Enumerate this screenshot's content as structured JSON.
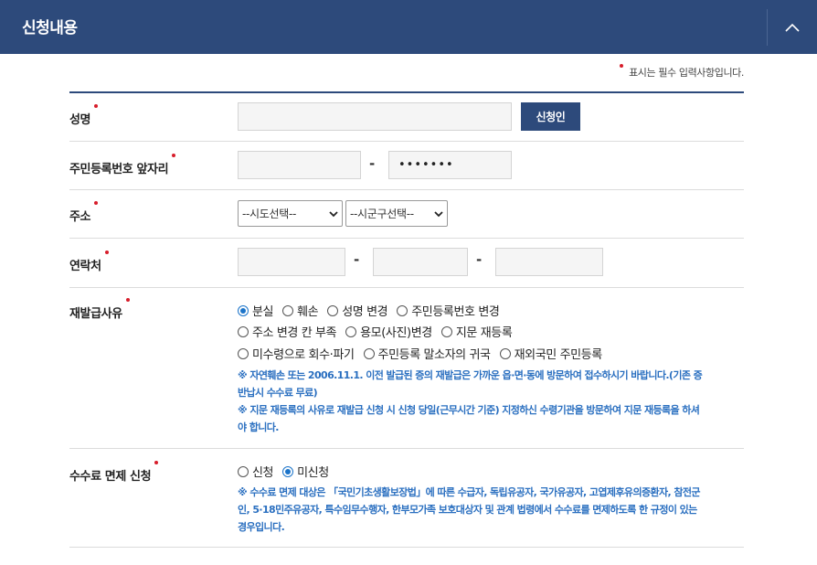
{
  "header": {
    "title": "신청내용",
    "collapse_icon": "chevron-up-icon"
  },
  "required_note": "표시는 필수 입력사항입니다.",
  "accent_color": "#2d4a7b",
  "required_dot_color": "#d71d2b",
  "note_color": "#2a6fc0",
  "name_row": {
    "label": "성명",
    "value": "",
    "button_label": "신청인"
  },
  "rrn_row": {
    "label": "주민등록번호 앞자리",
    "front_value": "",
    "back_value": "•••••••",
    "separator": "-"
  },
  "address_row": {
    "label": "주소",
    "sido_selected": "--시도선택--",
    "sigungu_selected": "--시군구선택--"
  },
  "contact_row": {
    "label": "연락처",
    "part1": "",
    "part2": "",
    "part3": "",
    "separator": "-"
  },
  "reason_row": {
    "label": "재발급사유",
    "lines": [
      [
        {
          "label": "분실",
          "checked": true
        },
        {
          "label": "훼손",
          "checked": false
        },
        {
          "label": "성명 변경",
          "checked": false
        },
        {
          "label": "주민등록번호 변경",
          "checked": false
        }
      ],
      [
        {
          "label": "주소 변경 칸 부족",
          "checked": false
        },
        {
          "label": "용모(사진)변경",
          "checked": false
        },
        {
          "label": "지문 재등록",
          "checked": false
        }
      ],
      [
        {
          "label": "미수령으로 회수·파기",
          "checked": false
        },
        {
          "label": "주민등록 말소자의 귀국",
          "checked": false
        },
        {
          "label": "재외국민 주민등록",
          "checked": false
        }
      ]
    ],
    "note1_line1": "※ 자연훼손 또는 2006.11.1. 이전 발급된 증의 재발급은 가까운 읍·면·동에 방문하여 접수하시기 바랍니다.(기존 증",
    "note1_line2": "반납시 수수료 무료)",
    "note2_line1": "※ 지문 재등록의 사유로 재발급 신청 시 신청 당일(근무시간 기준) 지정하신 수령기관을 방문하여 지문 재등록을 하셔",
    "note2_line2": "야 합니다."
  },
  "fee_row": {
    "label": "수수료 면제 신청",
    "options": [
      {
        "label": "신청",
        "checked": false
      },
      {
        "label": "미신청",
        "checked": true
      }
    ],
    "note_line1": "※ 수수료 면제 대상은 「국민기초생활보장법」에 따른 수급자, 독립유공자, 국가유공자, 고엽제후유의증환자, 참전군",
    "note_line2": "인, 5·18민주유공자, 특수임무수행자, 한부모가족 보호대상자 및 관계 법령에서 수수료를 면제하도록 한 규정이 있는",
    "note_line3": "경우입니다."
  }
}
